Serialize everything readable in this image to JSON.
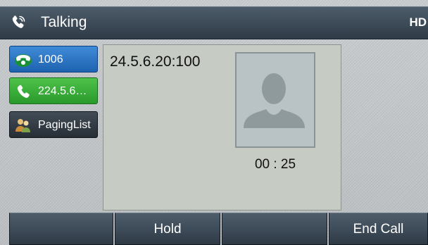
{
  "header": {
    "status": "Talking",
    "hd_badge": "HD"
  },
  "lines": [
    {
      "label": "1006",
      "icon": "phone-handset-icon",
      "color": "#2f7bcc"
    },
    {
      "label": "224.5.6…",
      "icon": "phone-talking-icon",
      "color": "#3aae3a"
    },
    {
      "label": "PagingList",
      "icon": "paging-group-icon",
      "color": "#333c45"
    }
  ],
  "call": {
    "remote": "24.5.6.20:100",
    "duration": "00 : 25",
    "avatar_icon": "contact-avatar-icon"
  },
  "softkeys": [
    "",
    "Hold",
    "",
    "End Call"
  ]
}
